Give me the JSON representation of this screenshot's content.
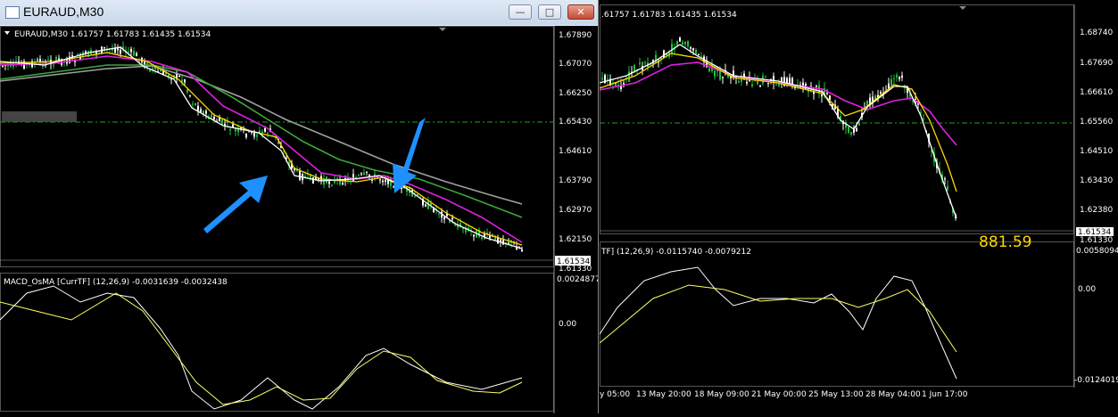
{
  "left_window": {
    "title": "EURAUD,M30",
    "buttons": {
      "minimize": "—",
      "maximize": "□",
      "close": "✕"
    },
    "header": "EURAUD,M30  1.61757 1.61783 1.61435 1.61534",
    "price_scale": [
      "1.67890",
      "1.67070",
      "1.66250",
      "1.65430",
      "1.64610",
      "1.63790",
      "1.62970",
      "1.62150",
      "1.61330"
    ],
    "current_price": "1.61534",
    "indicator_header": "MACD_OsMA [CurrTF] (12,26,9) -0.0031639 -0.0032438",
    "indicator_scale": {
      "top": "0.0024877",
      "zero": "0.00"
    }
  },
  "right_window": {
    "header": ".61757 1.61783 1.61435 1.61534",
    "price_scale": [
      "1.68740",
      "1.67690",
      "1.66610",
      "1.65560",
      "1.64510",
      "1.63430",
      "1.62380"
    ],
    "current_price": "1.61534",
    "last_scale": "1.61330",
    "overlay_text": "881.59",
    "indicator_header": "TF] (12,26,9) -0.0115740 -0.0079212",
    "indicator_scale": {
      "top": "0.0058094",
      "zero": "0.00",
      "bottom": "-0.0124019"
    },
    "time_axis": [
      "y 05:00",
      "13 May 20:00",
      "18 May 09:00",
      "21 May 00:00",
      "25 May 13:00",
      "28 May 04:00",
      "1 Jun 17:00"
    ]
  },
  "colors": {
    "bull_candle": "#1fbf3a",
    "bear_candle": "#ffffff",
    "ma_fast": "#ffffff",
    "ma_yellow": "#ffd700",
    "ma_magenta": "#e020e0",
    "ma_green": "#3ca83c",
    "ma_gray": "#a0a0a0",
    "hist_positive": "#d42020",
    "hist_negative": "#3cbf3c",
    "signal": "#ffff66",
    "macd_line": "#ffffff",
    "arrow": "#1e90ff",
    "level_line": "#2a9d2a"
  },
  "annotations": [
    {
      "name": "up-arrow-annotation",
      "icon": "blue-arrow-icon"
    },
    {
      "name": "down-arrow-annotation",
      "icon": "blue-arrow-icon"
    }
  ]
}
